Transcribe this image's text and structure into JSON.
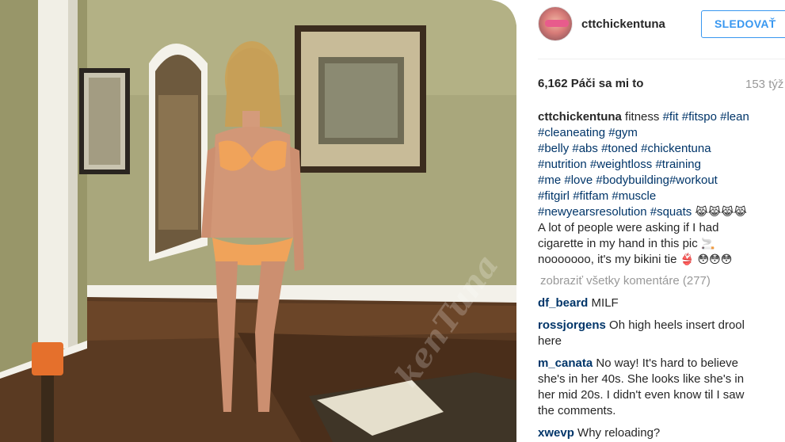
{
  "post": {
    "photo_watermark": "kenTuna",
    "author": "cttchickentuna",
    "follow_label": "SLEDOVAŤ",
    "likes_text": "6,162 Páči sa mi to",
    "time_text": "153 týž",
    "caption": {
      "username": "cttchickentuna",
      "lines": [
        {
          "text": "fitness",
          "tags": [
            "#fit",
            "#fitspo",
            "#lean"
          ]
        },
        {
          "tags": [
            "#cleaneating",
            "#gym"
          ]
        },
        {
          "tags": [
            "#belly",
            "#abs",
            "#toned",
            "#chickentuna"
          ]
        },
        {
          "tags": [
            "#nutrition",
            "#weightloss",
            "#training"
          ]
        },
        {
          "tags": [
            "#me",
            "#love",
            "#bodybuilding#workout"
          ]
        },
        {
          "tags": [
            "#fitgirl",
            "#fitfam",
            "#muscle"
          ]
        },
        {
          "tags": [
            "#newyearsresolution",
            "#squats"
          ],
          "emoji": "😹😹😹😹"
        },
        {
          "text": "A lot of people were asking if I had"
        },
        {
          "text": "cigarette in my hand in this pic",
          "emoji": "🚬"
        },
        {
          "text": "nooooooo, it's my bikini tie",
          "emoji": "👙 😳😳😳"
        }
      ]
    },
    "view_all_comments": "zobraziť všetky komentáre (277)",
    "comments": [
      {
        "user": "df_beard",
        "text": "MILF"
      },
      {
        "user": "rossjorgens",
        "text": "Oh high heels insert drool",
        "text2": "here"
      },
      {
        "user": "m_canata",
        "text": "No way! It's hard to believe",
        "lines": [
          "she's in her 40s. She looks like she's in",
          "her mid 20s. I didn't even know til I saw",
          "the comments."
        ]
      },
      {
        "user": "xwevp",
        "text": "Why reloading?"
      }
    ]
  }
}
